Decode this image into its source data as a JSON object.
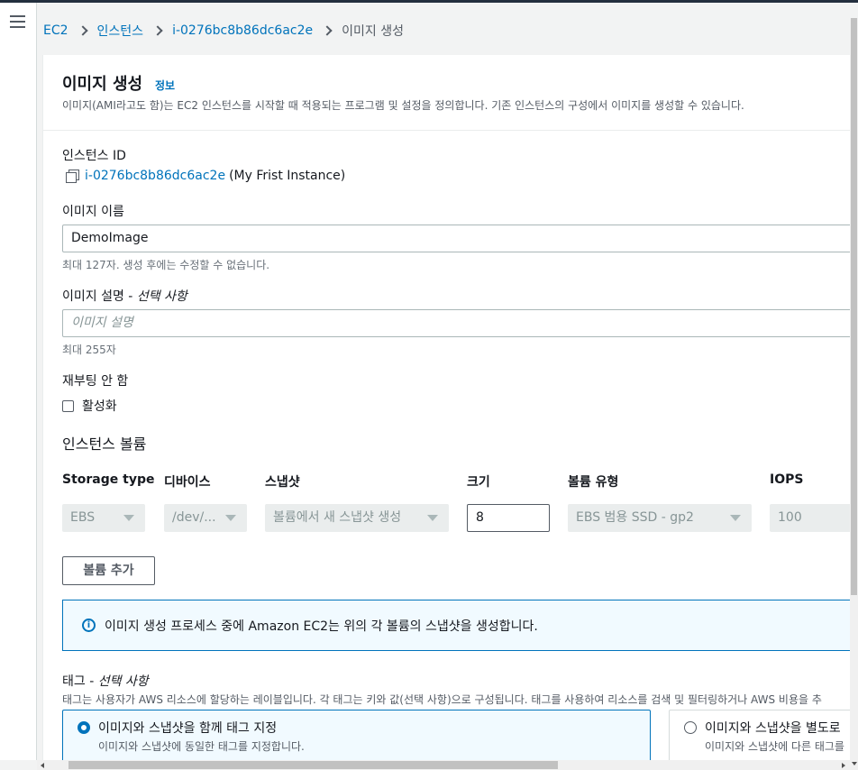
{
  "breadcrumb": {
    "items": [
      "EC2",
      "인스턴스",
      "i-0276bc8b86dc6ac2e"
    ],
    "current": "이미지 생성"
  },
  "header": {
    "title": "이미지 생성",
    "info": "정보",
    "description": "이미지(AMI라고도 함)는 EC2 인스턴스를 시작할 때 적용되는 프로그램 및 설정을 정의합니다. 기존 인스턴스의 구성에서 이미지를 생성할 수 있습니다."
  },
  "instance": {
    "label": "인스턴스 ID",
    "id": "i-0276bc8b86dc6ac2e",
    "name": "(My Frist Instance)"
  },
  "image_name": {
    "label": "이미지 이름",
    "value": "DemoImage",
    "hint": "최대 127자. 생성 후에는 수정할 수 없습니다."
  },
  "image_desc": {
    "label": "이미지 설명 - ",
    "optional": "선택 사항",
    "placeholder": "이미지 설명",
    "hint": "최대 255자"
  },
  "no_reboot": {
    "label": "재부팅 안 함",
    "checkbox_label": "활성화",
    "checked": false
  },
  "volumes": {
    "title": "인스턴스 볼륨",
    "columns": [
      "Storage type",
      "디바이스",
      "스냅샷",
      "크기",
      "볼륨 유형",
      "IOPS"
    ],
    "row": {
      "storage_type": "EBS",
      "device": "/dev/...",
      "snapshot": "볼륨에서 새 스냅샷 생성",
      "size": "8",
      "volume_type": "EBS 범용 SSD - gp2",
      "iops": "100"
    },
    "add_button": "볼륨 추가"
  },
  "alert": {
    "icon": "info-icon",
    "text": "이미지 생성 프로세스 중에 Amazon EC2는 위의 각 볼륨의 스냅샷을 생성합니다."
  },
  "tags": {
    "label": "태그 - ",
    "optional": "선택 사항",
    "description": "태그는 사용자가 AWS 리소스에 할당하는 레이블입니다. 각 태그는 키와 값(선택 사항)으로 구성됩니다. 태그를 사용하여 리소스를 검색 및 필터링하거나 AWS 비용을 추",
    "options": [
      {
        "title": "이미지와 스냅샷을 함께 태그 지정",
        "desc": "이미지와 스냅샷에 동일한 태그를 지정합니다.",
        "selected": true
      },
      {
        "title": "이미지와 스냅샷을 별도로",
        "desc": "이미지와 스냅샷에 다른 태그를",
        "selected": false
      }
    ]
  },
  "colors": {
    "link": "#0073bb",
    "header_bar": "#232f3e",
    "alert_bg": "#f1faff",
    "text": "#16191f"
  }
}
